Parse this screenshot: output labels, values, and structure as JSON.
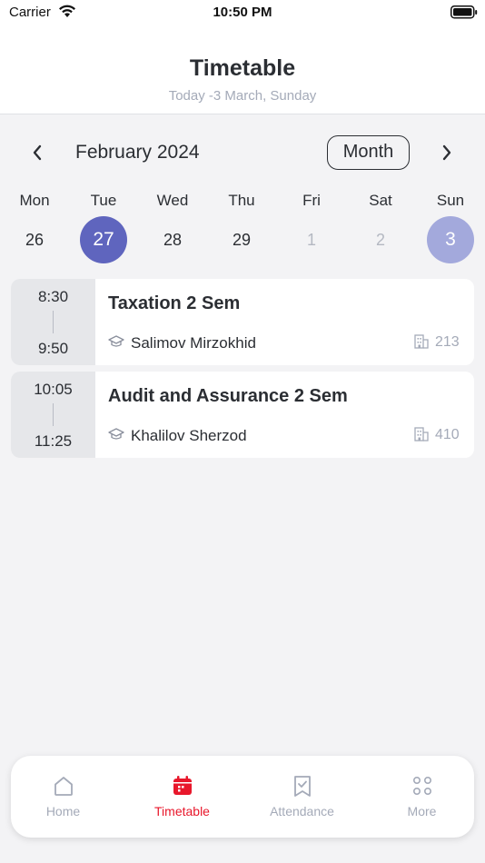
{
  "status_bar": {
    "carrier": "Carrier",
    "time": "10:50 PM"
  },
  "header": {
    "title": "Timetable",
    "subtitle": "Today -3 March, Sunday"
  },
  "calendar": {
    "month_label": "February 2024",
    "view_toggle": "Month",
    "days": [
      {
        "name": "Mon",
        "num": "26",
        "state": "normal"
      },
      {
        "name": "Tue",
        "num": "27",
        "state": "selected"
      },
      {
        "name": "Wed",
        "num": "28",
        "state": "normal"
      },
      {
        "name": "Thu",
        "num": "29",
        "state": "normal"
      },
      {
        "name": "Fri",
        "num": "1",
        "state": "muted"
      },
      {
        "name": "Sat",
        "num": "2",
        "state": "muted"
      },
      {
        "name": "Sun",
        "num": "3",
        "state": "today"
      }
    ]
  },
  "classes": [
    {
      "start": "8:30",
      "end": "9:50",
      "title": "Taxation 2 Sem",
      "teacher": "Salimov Mirzokhid",
      "room": "213"
    },
    {
      "start": "10:05",
      "end": "11:25",
      "title": "Audit and Assurance 2 Sem",
      "teacher": "Khalilov Sherzod",
      "room": "410"
    }
  ],
  "tabs": [
    {
      "label": "Home",
      "icon": "home-icon"
    },
    {
      "label": "Timetable",
      "icon": "calendar-icon",
      "active": true
    },
    {
      "label": "Attendance",
      "icon": "attendance-icon"
    },
    {
      "label": "More",
      "icon": "more-grid-icon"
    }
  ],
  "colors": {
    "accent_selected": "#5f65be",
    "accent_today": "#a3a9dc",
    "tab_active": "#e8172b",
    "muted_text": "#a4aab8"
  }
}
